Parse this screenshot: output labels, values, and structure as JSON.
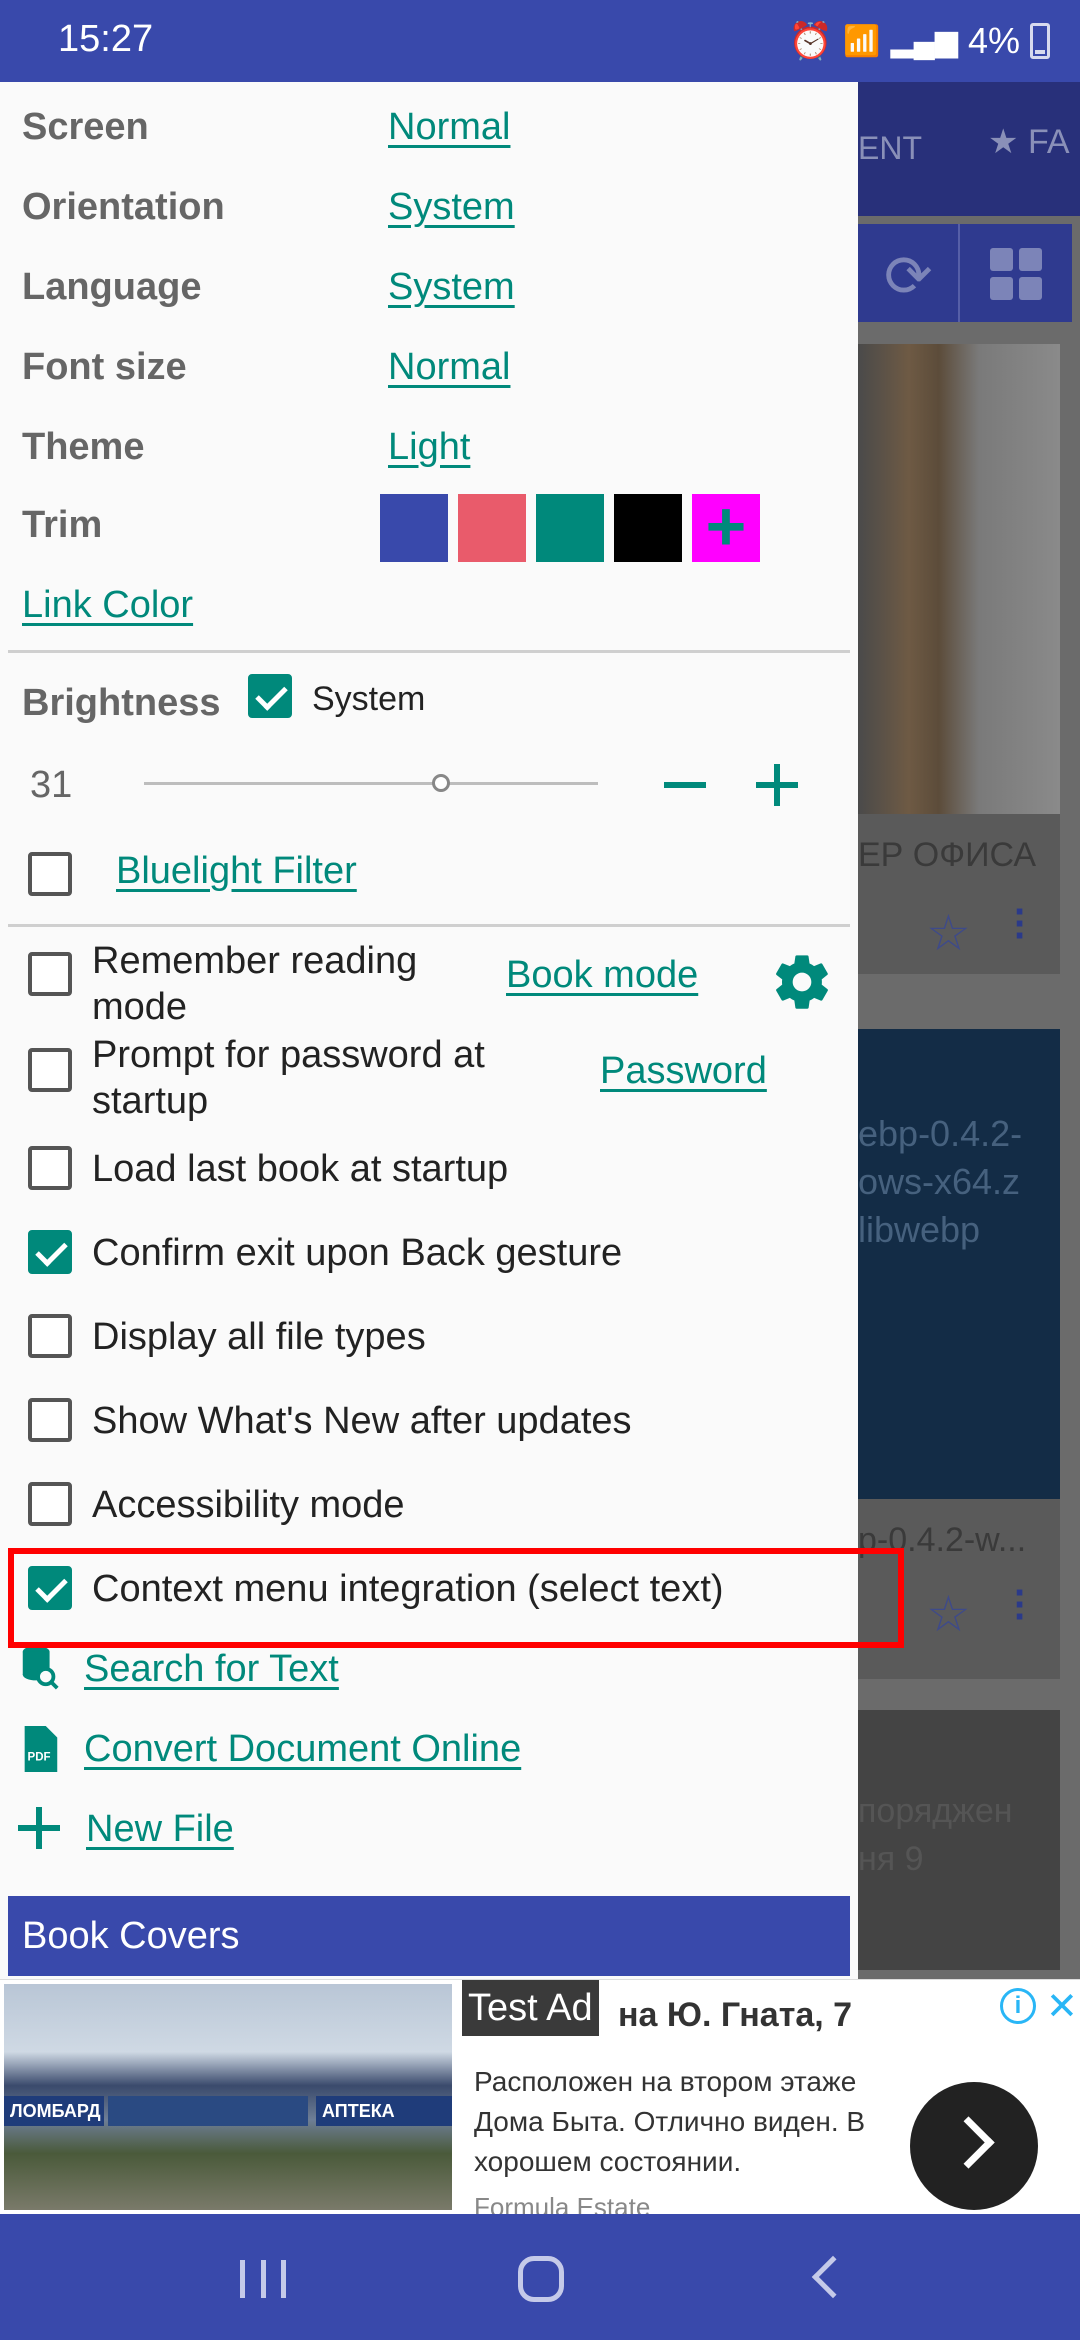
{
  "status_bar": {
    "time": "15:27",
    "battery": "4%"
  },
  "settings": {
    "screen": {
      "label": "Screen",
      "value": "Normal"
    },
    "orientation": {
      "label": "Orientation",
      "value": "System"
    },
    "language": {
      "label": "Language",
      "value": "System"
    },
    "font_size": {
      "label": "Font size",
      "value": "Normal"
    },
    "theme": {
      "label": "Theme",
      "value": "Light"
    },
    "trim": {
      "label": "Trim",
      "colors": [
        "#3949ab",
        "#e95b6b",
        "#00897b",
        "#000000"
      ],
      "add_color": "#ff00ff"
    },
    "link_color": "Link Color"
  },
  "brightness": {
    "label": "Brightness",
    "system_label": "System",
    "system_checked": true,
    "value": "31",
    "slider_fraction": 0.65,
    "bluelight_label": "Bluelight Filter",
    "bluelight_checked": false
  },
  "options": [
    {
      "label": "Remember reading mode",
      "checked": false,
      "link": "Book mode"
    },
    {
      "label": "Prompt for password at startup",
      "checked": false,
      "link": "Password"
    },
    {
      "label": "Load last book at startup",
      "checked": false
    },
    {
      "label": "Confirm exit upon Back gesture",
      "checked": true
    },
    {
      "label": "Display all file types",
      "checked": false
    },
    {
      "label": "Show What's New after updates",
      "checked": false
    },
    {
      "label": "Accessibility mode",
      "checked": false
    },
    {
      "label": "Context menu integration (select text)",
      "checked": true
    }
  ],
  "tools": {
    "search": "Search for Text",
    "convert": "Convert Document Online",
    "new_file": "New File"
  },
  "book_covers": "Book Covers",
  "background": {
    "tab1": "ENT",
    "tab2": "FA",
    "card1_title": "ЕР ОФИСА",
    "card2_text": [
      "ebp-0.4.2-",
      "ows-x64.z",
      "libwebp"
    ],
    "card2_title": "p-0.4.2-w...",
    "card3_text": [
      "поряджен",
      "ня 9"
    ]
  },
  "ad": {
    "tag": "Test Ad",
    "title": "на Ю. Гната, 7",
    "description": "Расположен на втором этаже Дома Быта. Отлично виден. В хорошем состоянии.",
    "source": "Formula Estate",
    "sign_left": "ЛОМБАРД",
    "sign_right": "АПТЕКА"
  },
  "colors": {
    "accent": "#00897b",
    "primary": "#3949ab",
    "highlight": "#ff0000"
  }
}
